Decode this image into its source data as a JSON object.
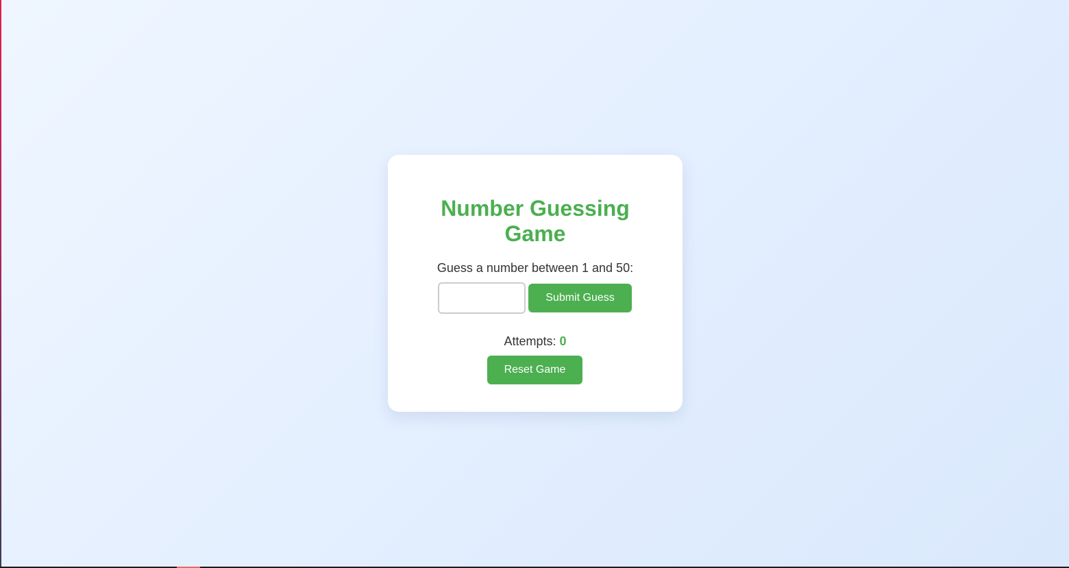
{
  "game": {
    "title": "Number Guessing Game",
    "prompt": "Guess a number between 1 and 50:",
    "input_value": "",
    "submit_label": "Submit Guess",
    "attempts_label": "Attempts:",
    "attempts_count": "0",
    "reset_label": "Reset Game"
  },
  "colors": {
    "accent": "#4caf50",
    "text": "#333333",
    "card_background": "#ffffff",
    "page_background": "#e4efff"
  }
}
